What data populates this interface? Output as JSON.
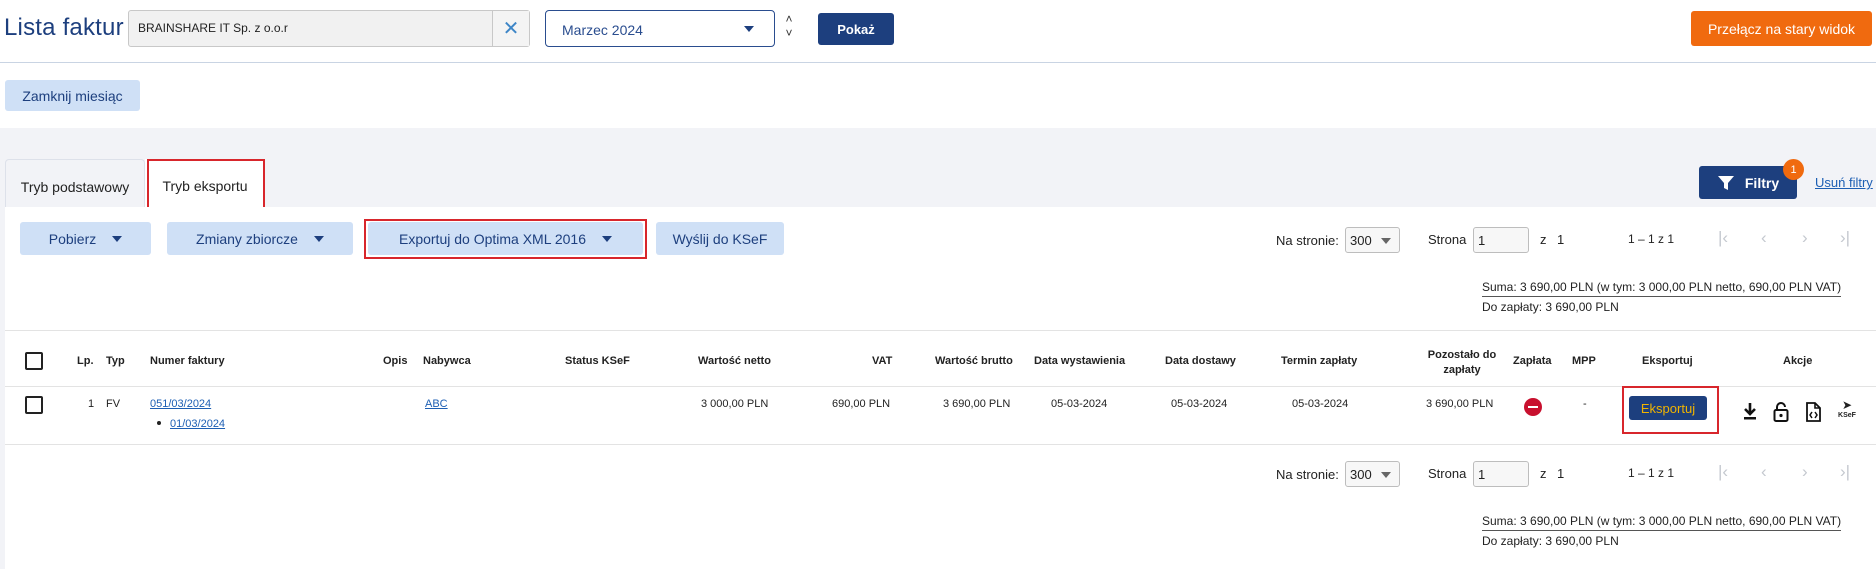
{
  "header": {
    "title": "Lista faktur",
    "company": "BRAINSHARE IT Sp. z o.o.r",
    "month": "Marzec 2024",
    "show_button": "Pokaż",
    "old_view_button": "Przełącz na stary widok"
  },
  "toolbar_top": {
    "close_month": "Zamknij miesiąc"
  },
  "tabs": {
    "basic": "Tryb podstawowy",
    "export": "Tryb eksportu"
  },
  "filters": {
    "button": "Filtry",
    "count": "1",
    "clear": "Usuń filtry"
  },
  "actions": {
    "download": "Pobierz",
    "bulk_changes": "Zmiany zbiorcze",
    "export_optima": "Exportuj do Optima XML 2016",
    "send_ksef": "Wyślij do KSeF"
  },
  "pager": {
    "per_page_label": "Na stronie:",
    "per_page_value": "300",
    "page_label": "Strona",
    "page_value": "1",
    "of_label": "z",
    "of_value": "1",
    "range": "1 – 1 z 1"
  },
  "summary": {
    "total": "Suma: 3 690,00 PLN (w tym: 3 000,00 PLN netto, 690,00 PLN VAT)",
    "due": "Do zapłaty: 3 690,00 PLN"
  },
  "table": {
    "headers": {
      "lp": "Lp.",
      "typ": "Typ",
      "numer": "Numer faktury",
      "opis": "Opis",
      "nabywca": "Nabywca",
      "status": "Status KSeF",
      "netto": "Wartość netto",
      "vat": "VAT",
      "brutto": "Wartość brutto",
      "data_wyst": "Data wystawienia",
      "data_dost": "Data dostawy",
      "termin": "Termin zapłaty",
      "pozostalo": "Pozostało do zapłaty",
      "zaplata": "Zapłata",
      "mpp": "MPP",
      "eksportuj": "Eksportuj",
      "akcje": "Akcje"
    },
    "rows": [
      {
        "lp": "1",
        "typ": "FV",
        "numer": "051/03/2024",
        "numer_sub": "01/03/2024",
        "nabywca": "ABC",
        "netto": "3 000,00 PLN",
        "vat": "690,00 PLN",
        "brutto": "3 690,00 PLN",
        "data_wyst": "05-03-2024",
        "data_dost": "05-03-2024",
        "termin": "05-03-2024",
        "pozostalo": "3 690,00 PLN",
        "mpp": "-",
        "export_button": "Eksportuj",
        "ksef_label": "KSeF"
      }
    ]
  },
  "icons": {
    "clear": "close-icon",
    "filter": "filter-icon",
    "payment_status": "stop-icon",
    "download": "download-icon",
    "unlock": "lock-icon",
    "xml": "xml-file-icon",
    "send": "send-ksef-icon"
  },
  "colors": {
    "primary": "#1d3f7e",
    "accent": "#f06a0f",
    "light_button": "#cfe0f6",
    "danger": "#c8102e",
    "highlight": "#d8262c"
  }
}
